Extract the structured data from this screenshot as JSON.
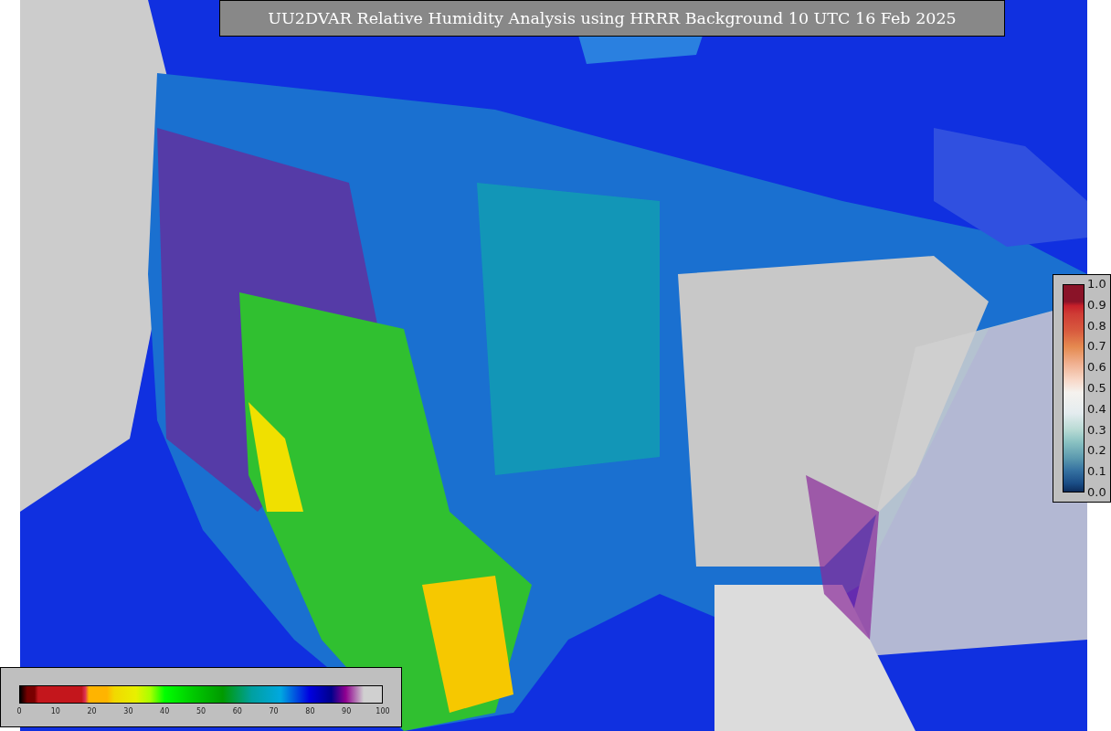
{
  "title": "UU2DVAR Relative Humidity Analysis using HRRR Background 10 UTC 16 Feb 2025",
  "humidity_legend": {
    "ticks": [
      "0",
      "10",
      "20",
      "30",
      "40",
      "50",
      "60",
      "70",
      "80",
      "90",
      "100"
    ]
  },
  "ratio_legend": {
    "ticks": [
      "1.0",
      "0.9",
      "0.8",
      "0.7",
      "0.6",
      "0.5",
      "0.4",
      "0.3",
      "0.2",
      "0.1",
      "0.0"
    ]
  }
}
